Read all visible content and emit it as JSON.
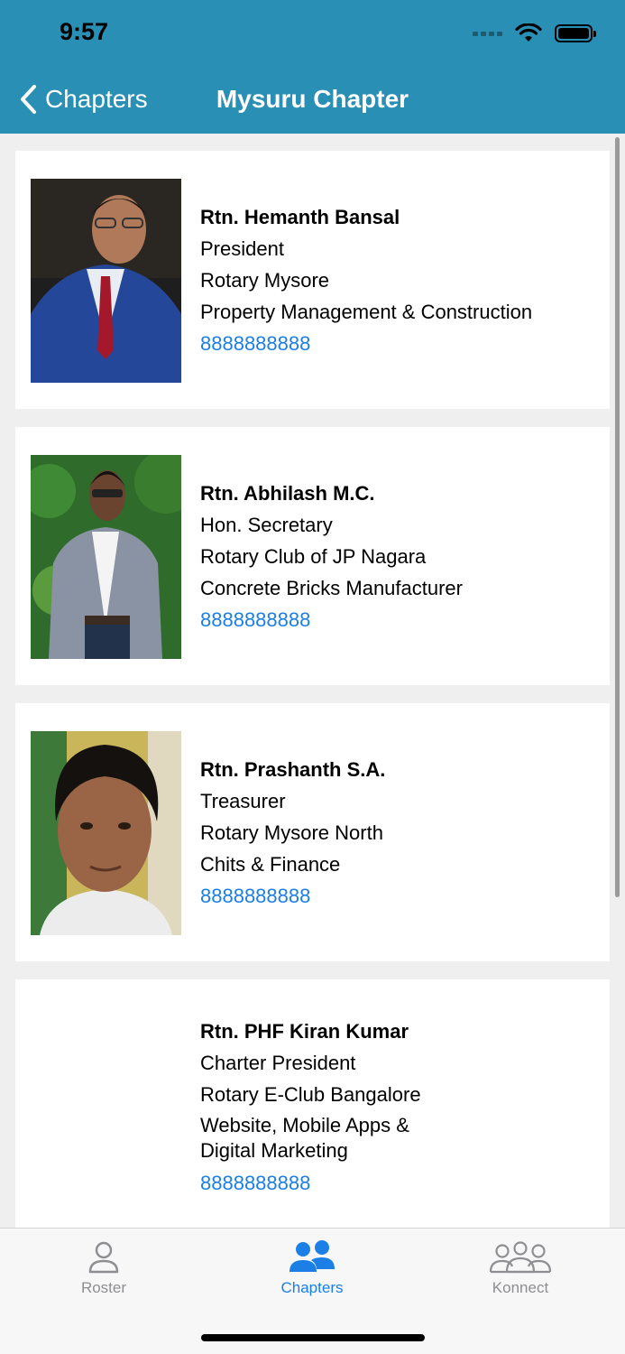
{
  "status_bar": {
    "time": "9:57"
  },
  "nav": {
    "back_label": "Chapters",
    "title": "Mysuru Chapter"
  },
  "members": [
    {
      "name": "Rtn. Hemanth Bansal",
      "role": "President",
      "club": "Rotary Mysore",
      "business": "Property Management & Construction",
      "phone": "8888888888"
    },
    {
      "name": "Rtn. Abhilash M.C.",
      "role": "Hon. Secretary",
      "club": "Rotary Club of JP Nagara",
      "business": "Concrete Bricks Manufacturer",
      "phone": "8888888888"
    },
    {
      "name": "Rtn. Prashanth S.A.",
      "role": "Treasurer",
      "club": "Rotary Mysore North",
      "business": "Chits & Finance",
      "phone": "8888888888"
    },
    {
      "name": "Rtn. PHF Kiran Kumar",
      "role": "Charter President",
      "club": "Rotary E-Club Bangalore",
      "business": "Website, Mobile Apps & Digital Marketing",
      "phone": "8888888888"
    }
  ],
  "tabs": [
    {
      "label": "Roster",
      "icon": "person-icon",
      "active": false
    },
    {
      "label": "Chapters",
      "icon": "people-icon",
      "active": true
    },
    {
      "label": "Konnect",
      "icon": "group-icon",
      "active": false
    }
  ],
  "colors": {
    "header": "#2a8fb4",
    "link": "#1b7fe6",
    "active_tab": "#1b7fe6",
    "inactive_tab": "#8e8e93"
  }
}
